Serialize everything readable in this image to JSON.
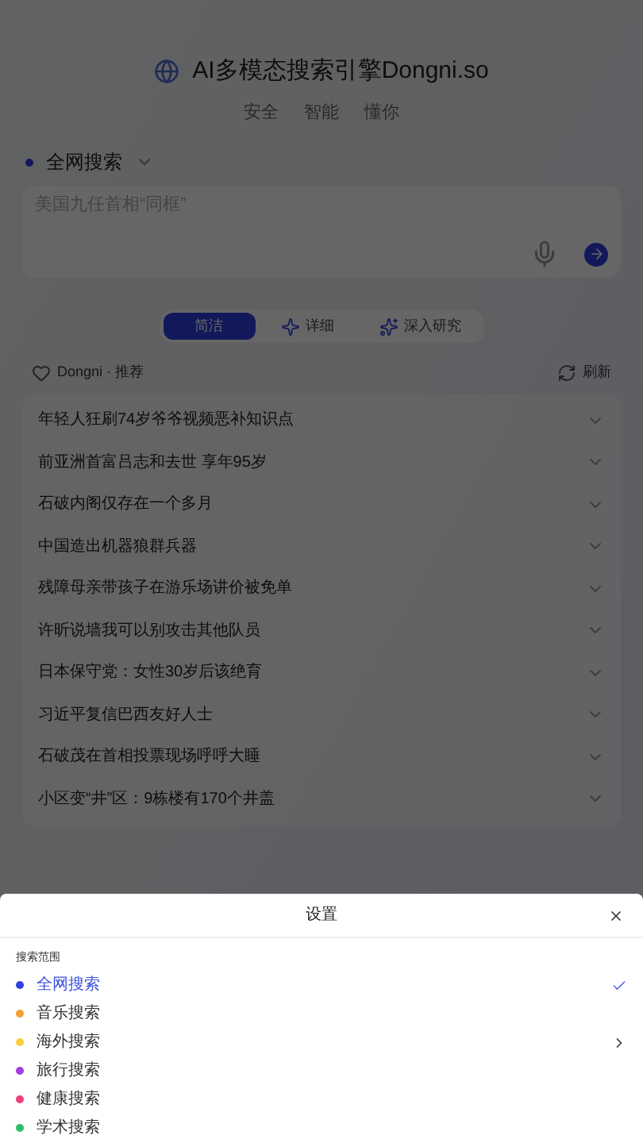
{
  "header": {
    "title": "AI多模态搜索引擎Dongni.so",
    "taglines": [
      "安全",
      "智能",
      "懂你"
    ]
  },
  "search": {
    "scope": "全网搜索",
    "placeholder": "美国九任首相“同框”"
  },
  "modes": [
    {
      "label": "简洁",
      "selected": true,
      "kind": "plain"
    },
    {
      "label": "详细",
      "selected": false,
      "kind": "sparkle"
    },
    {
      "label": "深入研究",
      "selected": false,
      "kind": "sparkles"
    }
  ],
  "recommend": {
    "title": "Dongni · 推荐",
    "refresh": "刷新",
    "items": [
      {
        "text": "年轻人狂刷74岁爷爷视频恶补知识点",
        "expanded": false
      },
      {
        "text": "前亚洲首富吕志和去世 享年95岁",
        "expanded": false
      },
      {
        "text": "石破内阁仅存在一个多月",
        "expanded": false
      },
      {
        "text": "中国造出机器狼群兵器",
        "expanded": false
      },
      {
        "text": "残障母亲带孩子在游乐场讲价被免单",
        "expanded": false
      },
      {
        "text": "许昕说墙我可以别攻击其他队员",
        "expanded": false
      },
      {
        "text": "日本保守党：女性30岁后该绝育",
        "expanded": false
      },
      {
        "text": "习近平复信巴西友好人士",
        "expanded": false
      },
      {
        "text": "石破茂在首相投票现场呼呼大睡",
        "expanded": false
      },
      {
        "text": "小区变“井”区：9栋楼有170个井盖",
        "expanded": false
      }
    ]
  },
  "sheet": {
    "title": "设置",
    "section": "搜索范围",
    "options": [
      {
        "label": "全网搜索",
        "color": "#2f3fe0",
        "selected": true,
        "submenu": false
      },
      {
        "label": "音乐搜索",
        "color": "#f5a031",
        "selected": false,
        "submenu": false
      },
      {
        "label": "海外搜索",
        "color": "#f7d03a",
        "selected": false,
        "submenu": true
      },
      {
        "label": "旅行搜索",
        "color": "#a23ce0",
        "selected": false,
        "submenu": false
      },
      {
        "label": "健康搜索",
        "color": "#ee3e7e",
        "selected": false,
        "submenu": false
      },
      {
        "label": "学术搜索",
        "color": "#2fbf6a",
        "selected": false,
        "submenu": false
      }
    ]
  }
}
